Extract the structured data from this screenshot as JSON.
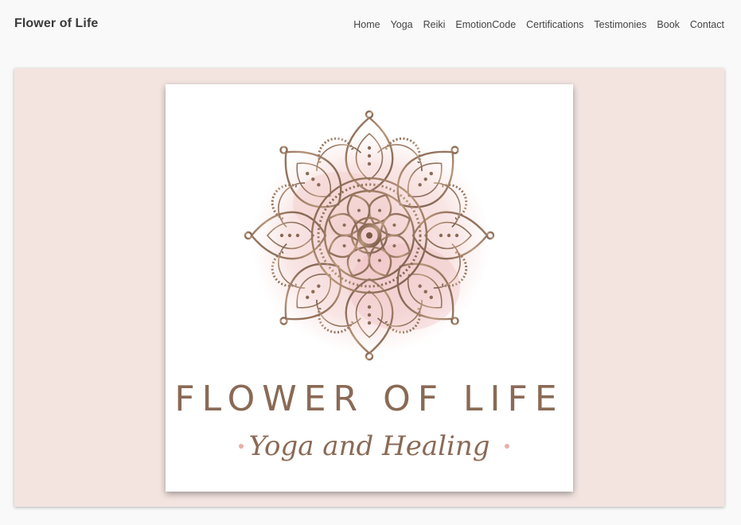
{
  "brand": {
    "title": "Flower of Life"
  },
  "nav": {
    "items": [
      {
        "label": "Home"
      },
      {
        "label": "Yoga"
      },
      {
        "label": "Reiki"
      },
      {
        "label": "EmotionCode"
      },
      {
        "label": "Certifications"
      },
      {
        "label": "Testimonies"
      },
      {
        "label": "Book"
      },
      {
        "label": "Contact"
      }
    ]
  },
  "logo": {
    "title": "FLOWER OF LIFE",
    "tagline": "Yoga and Healing",
    "icon": "mandala-icon",
    "colors": {
      "bronze": "#8a6a55",
      "gold": "#b39277",
      "blush": "#e8b4b8",
      "dot": "#e6b0a8"
    }
  },
  "theme": {
    "hero_bg": "#f3e4e0",
    "page_bg": "#f9f9f9"
  }
}
